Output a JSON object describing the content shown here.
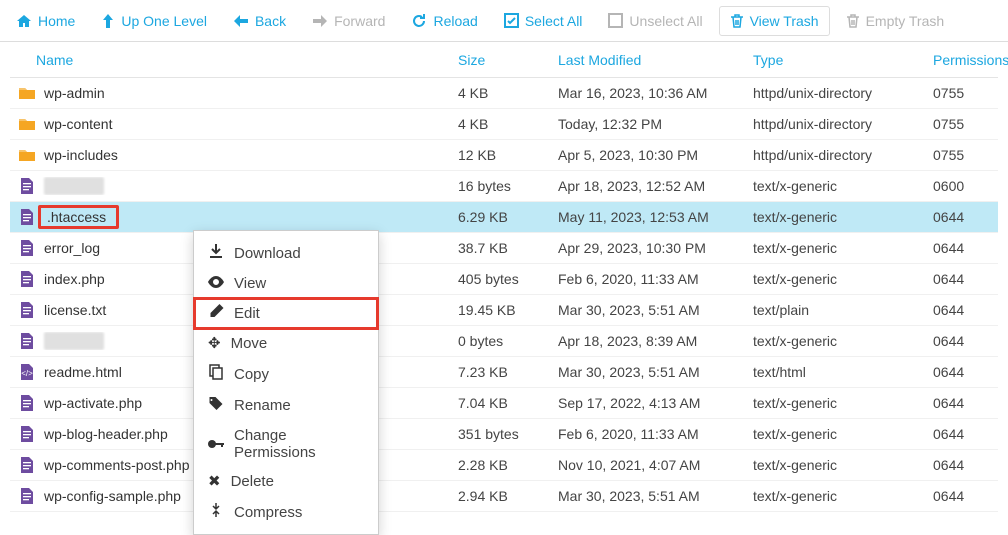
{
  "toolbar": {
    "home": "Home",
    "up": "Up One Level",
    "back": "Back",
    "forward": "Forward",
    "reload": "Reload",
    "select_all": "Select All",
    "unselect_all": "Unselect All",
    "view_trash": "View Trash",
    "empty_trash": "Empty Trash"
  },
  "headers": {
    "name": "Name",
    "size": "Size",
    "modified": "Last Modified",
    "type": "Type",
    "perm": "Permissions"
  },
  "rows": [
    {
      "icon": "folder",
      "name": "wp-admin",
      "size": "4 KB",
      "mod": "Mar 16, 2023, 10:36 AM",
      "type": "httpd/unix-directory",
      "perm": "0755"
    },
    {
      "icon": "folder",
      "name": "wp-content",
      "size": "4 KB",
      "mod": "Today, 12:32 PM",
      "type": "httpd/unix-directory",
      "perm": "0755"
    },
    {
      "icon": "folder",
      "name": "wp-includes",
      "size": "12 KB",
      "mod": "Apr 5, 2023, 10:30 PM",
      "type": "httpd/unix-directory",
      "perm": "0755"
    },
    {
      "icon": "file",
      "name": "",
      "blur": true,
      "size": "16 bytes",
      "mod": "Apr 18, 2023, 12:52 AM",
      "type": "text/x-generic",
      "perm": "0600"
    },
    {
      "icon": "file",
      "name": ".htaccess",
      "size": "6.29 KB",
      "mod": "May 11, 2023, 12:53 AM",
      "type": "text/x-generic",
      "perm": "0644",
      "selected": true,
      "redbox": true
    },
    {
      "icon": "file",
      "name": "error_log",
      "size": "38.7 KB",
      "mod": "Apr 29, 2023, 10:30 PM",
      "type": "text/x-generic",
      "perm": "0644"
    },
    {
      "icon": "file",
      "name": "index.php",
      "size": "405 bytes",
      "mod": "Feb 6, 2020, 11:33 AM",
      "type": "text/x-generic",
      "perm": "0644"
    },
    {
      "icon": "file",
      "name": "license.txt",
      "size": "19.45 KB",
      "mod": "Mar 30, 2023, 5:51 AM",
      "type": "text/plain",
      "perm": "0644"
    },
    {
      "icon": "file",
      "name": "",
      "blur": true,
      "size": "0 bytes",
      "mod": "Apr 18, 2023, 8:39 AM",
      "type": "text/x-generic",
      "perm": "0644"
    },
    {
      "icon": "html",
      "name": "readme.html",
      "size": "7.23 KB",
      "mod": "Mar 30, 2023, 5:51 AM",
      "type": "text/html",
      "perm": "0644"
    },
    {
      "icon": "file",
      "name": "wp-activate.php",
      "size": "7.04 KB",
      "mod": "Sep 17, 2022, 4:13 AM",
      "type": "text/x-generic",
      "perm": "0644"
    },
    {
      "icon": "file",
      "name": "wp-blog-header.php",
      "size": "351 bytes",
      "mod": "Feb 6, 2020, 11:33 AM",
      "type": "text/x-generic",
      "perm": "0644"
    },
    {
      "icon": "file",
      "name": "wp-comments-post.php",
      "size": "2.28 KB",
      "mod": "Nov 10, 2021, 4:07 AM",
      "type": "text/x-generic",
      "perm": "0644"
    },
    {
      "icon": "file",
      "name": "wp-config-sample.php",
      "size": "2.94 KB",
      "mod": "Mar 30, 2023, 5:51 AM",
      "type": "text/x-generic",
      "perm": "0644"
    }
  ],
  "context_menu": [
    {
      "icon": "download",
      "label": "Download"
    },
    {
      "icon": "eye",
      "label": "View"
    },
    {
      "icon": "pencil",
      "label": "Edit",
      "hl": true
    },
    {
      "icon": "move",
      "label": "Move"
    },
    {
      "icon": "copy",
      "label": "Copy"
    },
    {
      "icon": "tag",
      "label": "Rename"
    },
    {
      "icon": "key",
      "label": "Change Permissions"
    },
    {
      "icon": "x",
      "label": "Delete"
    },
    {
      "icon": "compress",
      "label": "Compress"
    }
  ]
}
